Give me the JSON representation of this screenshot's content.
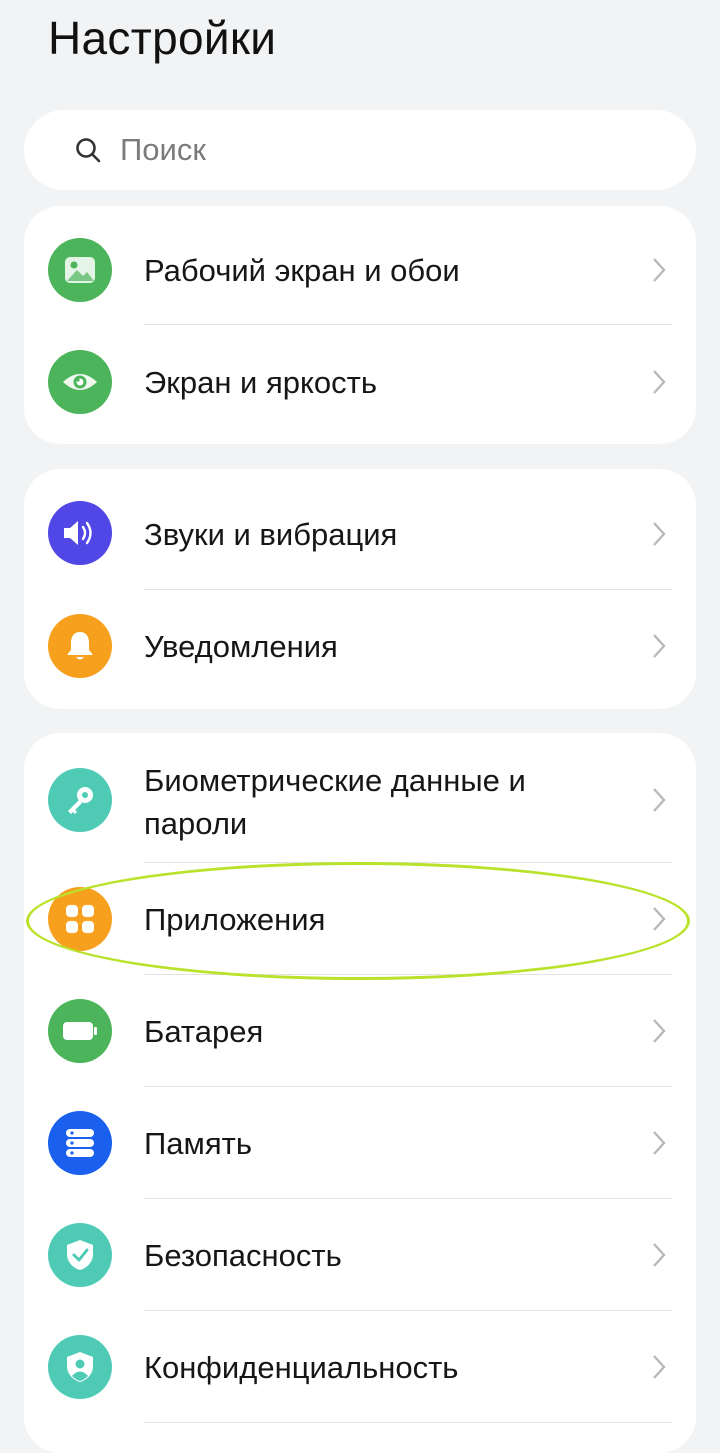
{
  "header": {
    "title": "Настройки"
  },
  "search": {
    "placeholder": "Поиск",
    "icon": "search-icon"
  },
  "groups": [
    {
      "items": [
        {
          "label": "Рабочий экран и обои",
          "icon": "wallpaper-icon",
          "color": "#4cb45a"
        },
        {
          "label": "Экран и яркость",
          "icon": "eye-icon",
          "color": "#4cb45a"
        }
      ]
    },
    {
      "items": [
        {
          "label": "Звуки и вибрация",
          "icon": "speaker-icon",
          "color": "#5147e6"
        },
        {
          "label": "Уведомления",
          "icon": "bell-icon",
          "color": "#f7a01e"
        }
      ]
    },
    {
      "items": [
        {
          "label": "Биометрические данные и пароли",
          "icon": "key-icon",
          "color": "#4fcbb5"
        },
        {
          "label": "Приложения",
          "icon": "apps-icon",
          "color": "#f7a01e",
          "highlighted": true
        },
        {
          "label": "Батарея",
          "icon": "battery-icon",
          "color": "#4cb45a"
        },
        {
          "label": "Память",
          "icon": "storage-icon",
          "color": "#1a5fee"
        },
        {
          "label": "Безопасность",
          "icon": "shield-check-icon",
          "color": "#4fcbb5"
        },
        {
          "label": "Конфиденциальность",
          "icon": "privacy-shield-icon",
          "color": "#4fcbb5"
        }
      ]
    }
  ],
  "colors": {
    "highlight_outline": "#b9e22a",
    "background": "#f1f3f5"
  }
}
